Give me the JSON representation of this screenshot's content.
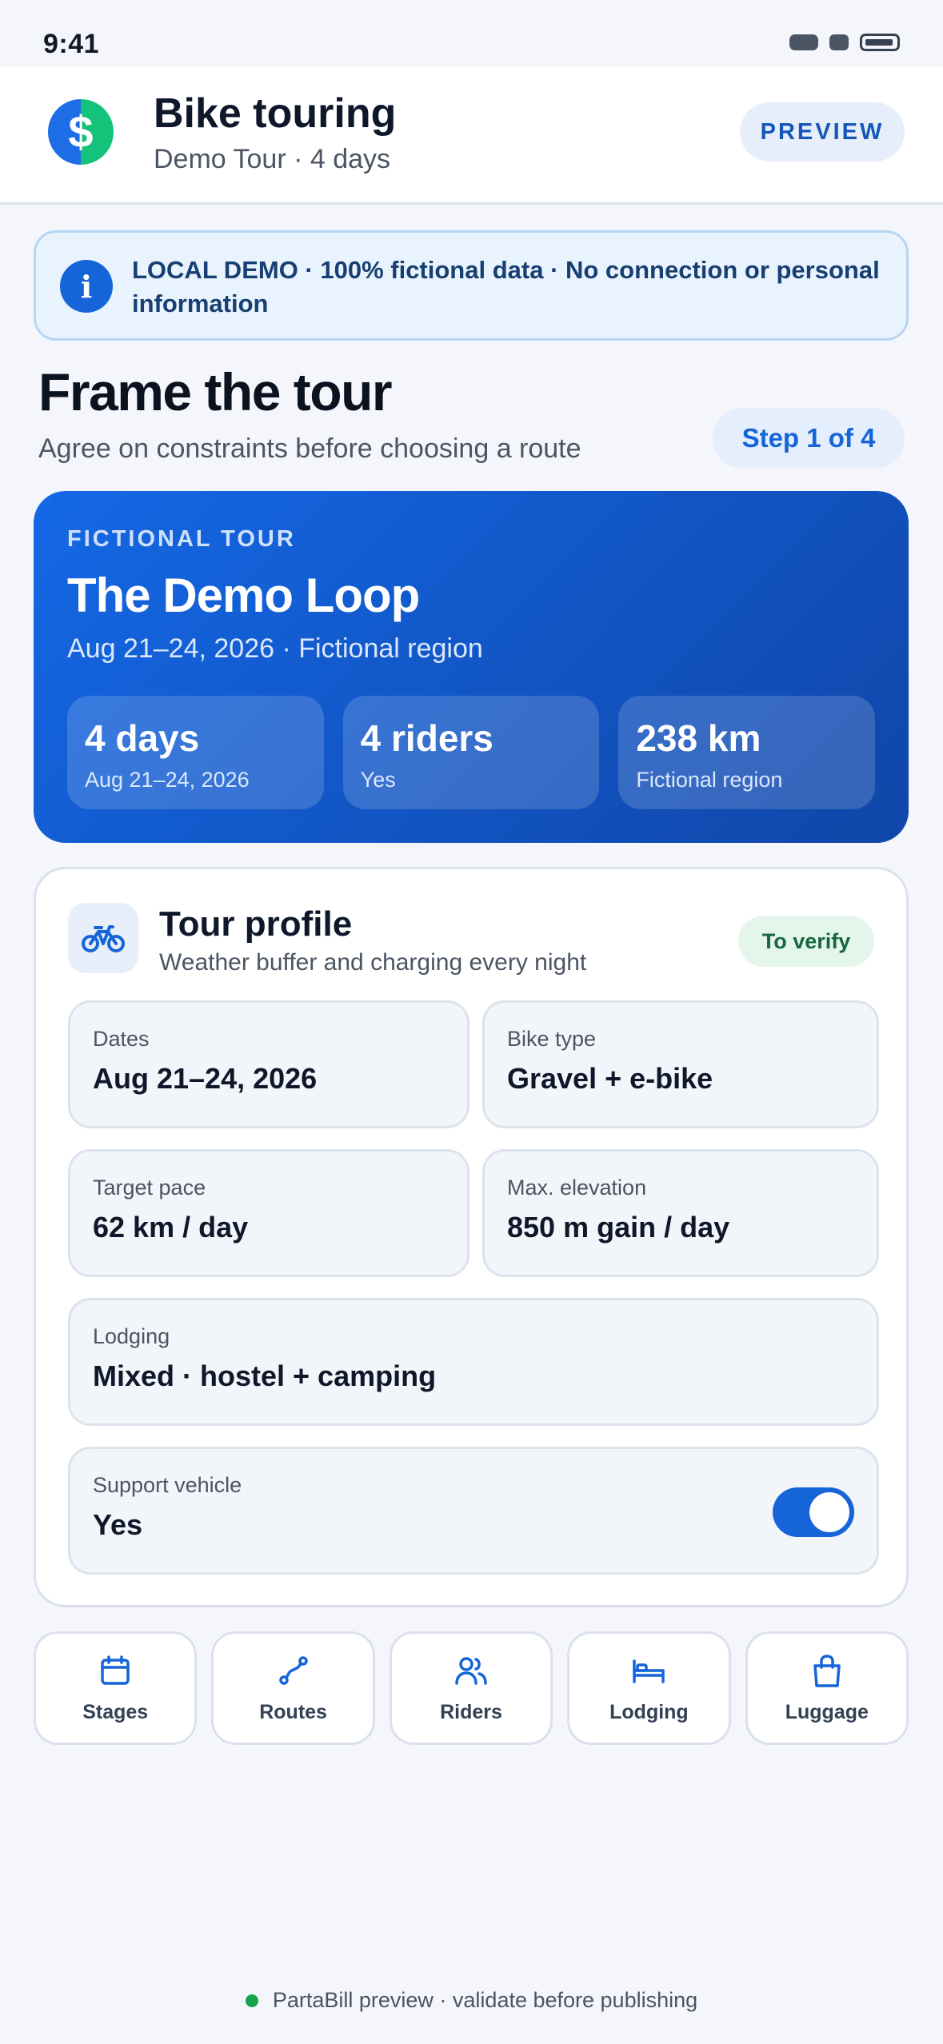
{
  "status_bar": {
    "time": "9:41"
  },
  "header": {
    "logo_glyph": "$",
    "title": "Bike touring",
    "subtitle": "Demo Tour · 4 days",
    "preview_label": "PREVIEW"
  },
  "banner": {
    "icon_glyph": "i",
    "text": "LOCAL DEMO · 100% fictional data · No connection or personal information"
  },
  "section": {
    "title": "Frame the tour",
    "subtitle": "Agree on constraints before choosing a route",
    "step": "Step 1 of 4"
  },
  "hero": {
    "kicker": "FICTIONAL TOUR",
    "title": "The Demo Loop",
    "subtitle": "Aug 21–24, 2026 · Fictional region",
    "stats": [
      {
        "value": "4 days",
        "label": "Aug 21–24, 2026"
      },
      {
        "value": "4 riders",
        "label": "Yes"
      },
      {
        "value": "238 km",
        "label": "Fictional region"
      }
    ]
  },
  "profile": {
    "title": "Tour profile",
    "subtitle": "Weather buffer and charging every night",
    "status": "To verify",
    "fields": {
      "dates": {
        "label": "Dates",
        "value": "Aug 21–24, 2026"
      },
      "bike_type": {
        "label": "Bike type",
        "value": "Gravel + e-bike"
      },
      "target_pace": {
        "label": "Target pace",
        "value": "62 km / day"
      },
      "max_elevation": {
        "label": "Max. elevation",
        "value": "850 m gain / day"
      },
      "lodging": {
        "label": "Lodging",
        "value": "Mixed · hostel + camping"
      },
      "support_vehicle": {
        "label": "Support vehicle",
        "value": "Yes",
        "toggle_on": true
      }
    }
  },
  "tabs": [
    {
      "label": "Stages",
      "icon": "calendar-icon"
    },
    {
      "label": "Routes",
      "icon": "route-icon"
    },
    {
      "label": "Riders",
      "icon": "users-icon"
    },
    {
      "label": "Lodging",
      "icon": "bed-icon"
    },
    {
      "label": "Luggage",
      "icon": "bag-icon"
    }
  ],
  "footer": {
    "text": "PartaBill preview · validate before publishing"
  },
  "colors": {
    "accent": "#1565d8",
    "hero_gradient_start": "#1468e6",
    "hero_gradient_end": "#1046a8",
    "success": "#16a34a"
  }
}
